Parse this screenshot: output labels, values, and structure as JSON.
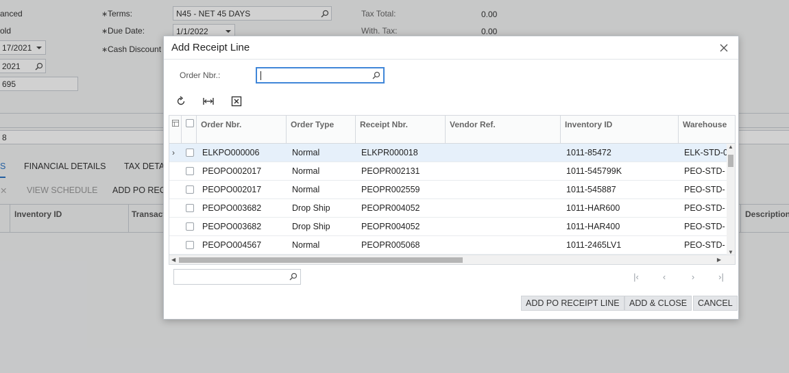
{
  "background": {
    "left_fields": [
      "anced",
      "old",
      "17/2021",
      "2021",
      "695",
      "8"
    ],
    "terms_label": "Terms:",
    "terms_value": "N45 - NET 45 DAYS",
    "due_date_label": "Due Date:",
    "due_date_value": "1/1/2022",
    "cash_discount_label": "Cash Discount",
    "tax_total_label": "Tax Total:",
    "tax_total_value": "0.00",
    "with_tax_label": "With. Tax:",
    "with_tax_value": "0.00",
    "tabs": [
      "S",
      "FINANCIAL DETAILS",
      "TAX DETA"
    ],
    "toolbar": {
      "close_glyph": "✕",
      "view_schedule": "VIEW SCHEDULE",
      "add_po_rec": "ADD PO REC"
    },
    "grid_headers": {
      "inventory_id": "Inventory ID",
      "transact": "Transact",
      "description": "Description"
    }
  },
  "dialog": {
    "title": "Add Receipt Line",
    "order_nbr_label": "Order Nbr.:",
    "order_nbr_value": "",
    "grid": {
      "columns": [
        "Order Nbr.",
        "Order Type",
        "Receipt Nbr.",
        "Vendor Ref.",
        "Inventory ID",
        "Warehouse"
      ],
      "rows": [
        {
          "order_nbr": "ELKPO000006",
          "order_type": "Normal",
          "receipt_nbr": "ELKPR000018",
          "vendor_ref": "",
          "inventory_id": "1011-85472",
          "warehouse": "ELK-STD-0"
        },
        {
          "order_nbr": "PEOPO002017",
          "order_type": "Normal",
          "receipt_nbr": "PEOPR002131",
          "vendor_ref": "",
          "inventory_id": "1011-545799K",
          "warehouse": "PEO-STD-"
        },
        {
          "order_nbr": "PEOPO002017",
          "order_type": "Normal",
          "receipt_nbr": "PEOPR002559",
          "vendor_ref": "",
          "inventory_id": "1011-545887",
          "warehouse": "PEO-STD-"
        },
        {
          "order_nbr": "PEOPO003682",
          "order_type": "Drop Ship",
          "receipt_nbr": "PEOPR004052",
          "vendor_ref": "",
          "inventory_id": "1011-HAR600",
          "warehouse": "PEO-STD-"
        },
        {
          "order_nbr": "PEOPO003682",
          "order_type": "Drop Ship",
          "receipt_nbr": "PEOPR004052",
          "vendor_ref": "",
          "inventory_id": "1011-HAR400",
          "warehouse": "PEO-STD-"
        },
        {
          "order_nbr": "PEOPO004567",
          "order_type": "Normal",
          "receipt_nbr": "PEOPR005068",
          "vendor_ref": "",
          "inventory_id": "1011-2465LV1",
          "warehouse": "PEO-STD-"
        }
      ]
    },
    "buttons": {
      "add_po_receipt_line": "ADD PO RECEIPT LINE",
      "add_close": "ADD & CLOSE",
      "cancel": "CANCEL"
    },
    "colors": {
      "focus_border": "#3f86d8",
      "selected_row": "#e6f0fa",
      "button_bg": "#e3e5e8"
    }
  }
}
